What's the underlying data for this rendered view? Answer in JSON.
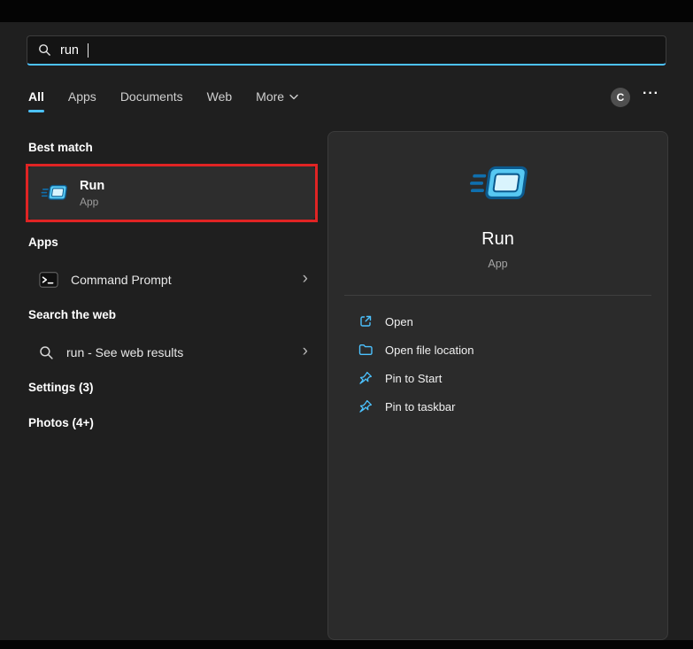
{
  "colors": {
    "accent": "#4cc2ff",
    "annotation": "#e02424",
    "panel": "#1f1f1f",
    "card": "#2b2b2b"
  },
  "search": {
    "value": "run"
  },
  "tabs": [
    {
      "label": "All"
    },
    {
      "label": "Apps"
    },
    {
      "label": "Documents"
    },
    {
      "label": "Web"
    },
    {
      "label": "More"
    }
  ],
  "header": {
    "avatar_letter": "C"
  },
  "icons": {
    "chevron_right": "›",
    "ellipsis": "···"
  },
  "results": {
    "best_match_heading": "Best match",
    "best_match": {
      "title": "Run",
      "subtitle": "App"
    },
    "apps_heading": "Apps",
    "apps": [
      {
        "label": "Command Prompt"
      }
    ],
    "web_heading": "Search the web",
    "web": [
      {
        "label": "run - See web results"
      }
    ],
    "collapsed_sections": [
      {
        "label": "Settings (3)"
      },
      {
        "label": "Photos (4+)"
      }
    ]
  },
  "preview": {
    "title": "Run",
    "subtitle": "App",
    "actions": [
      {
        "label": "Open"
      },
      {
        "label": "Open file location"
      },
      {
        "label": "Pin to Start"
      },
      {
        "label": "Pin to taskbar"
      }
    ]
  }
}
